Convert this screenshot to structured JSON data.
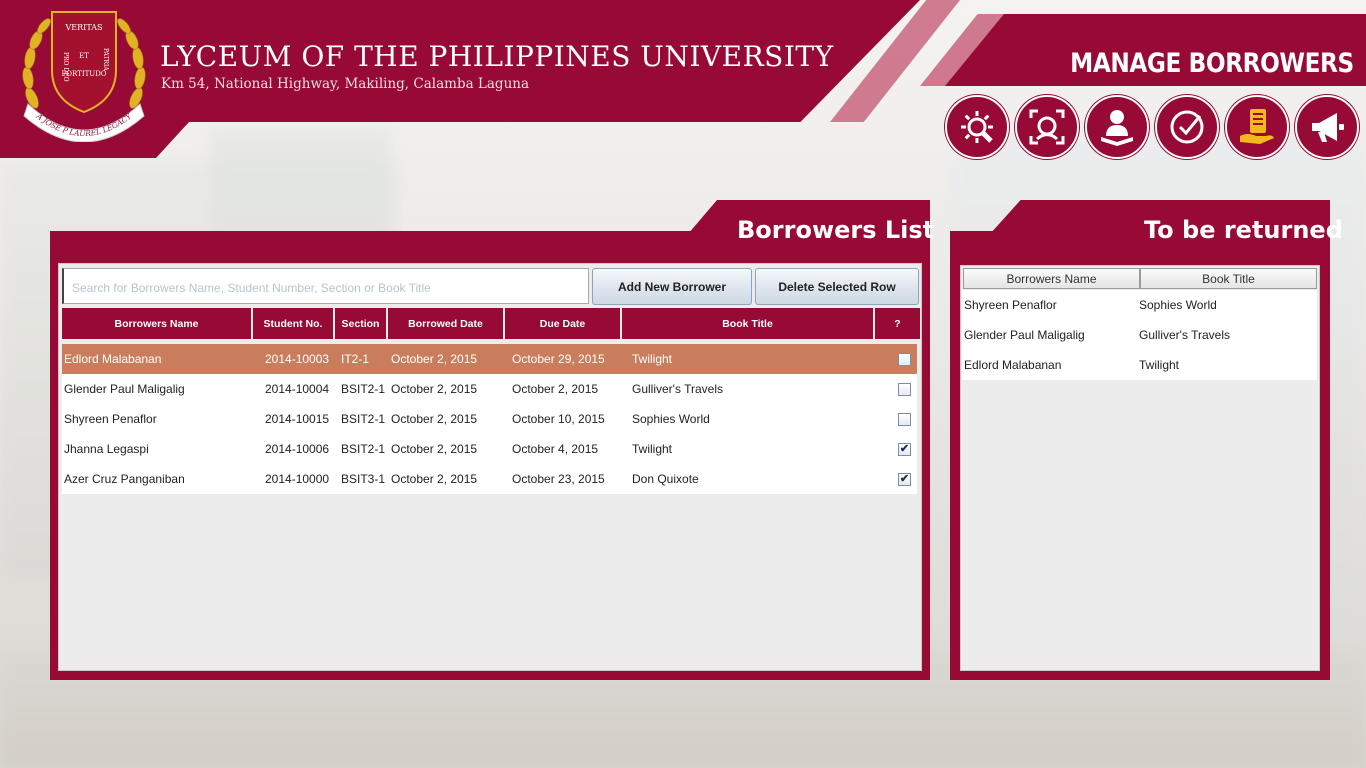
{
  "header": {
    "university_name": "LYCEUM OF THE PHILIPPINES UNIVERSITY",
    "address": "Km 54, National Highway, Makiling, Calamba Laguna",
    "page_title": "MANAGE BORROWERS",
    "logo": {
      "top_words": [
        "VERITAS",
        "ET"
      ],
      "left_word": "PRO DEO",
      "right_word": "PATRIA",
      "bottom_word": "FORTITUDO",
      "ribbon": "A JOSE P LAUREL LEGACY"
    }
  },
  "nav_icons": [
    "settings-tools-icon",
    "face-scan-icon",
    "reader-icon",
    "clock-check-icon",
    "book-hand-icon",
    "megaphone-icon"
  ],
  "borrowers_panel": {
    "title": "Borrowers List",
    "search_placeholder": "Search for Borrowers Name, Student Number, Section or Book Title",
    "add_button": "Add New Borrower",
    "delete_button": "Delete Selected Row",
    "columns": [
      "Borrowers Name",
      "Student No.",
      "Section",
      "Borrowed Date",
      "Due Date",
      "Book Title",
      "?"
    ],
    "rows": [
      {
        "name": "Edlord Malabanan",
        "student_no": "2014-10003",
        "section": "IT2-1",
        "borrowed": "October 2, 2015",
        "due": "October 29, 2015",
        "book": "Twilight",
        "checked": false,
        "selected": true
      },
      {
        "name": "Glender Paul Maligalig",
        "student_no": "2014-10004",
        "section": "BSIT2-1",
        "borrowed": "October 2, 2015",
        "due": "October 2, 2015",
        "book": "Gulliver's Travels",
        "checked": false,
        "selected": false
      },
      {
        "name": "Shyreen Penaflor",
        "student_no": "2014-10015",
        "section": "BSIT2-1",
        "borrowed": "October 2, 2015",
        "due": "October 10, 2015",
        "book": "Sophies World",
        "checked": false,
        "selected": false
      },
      {
        "name": "Jhanna Legaspi",
        "student_no": "2014-10006",
        "section": "BSIT2-1",
        "borrowed": "October 2, 2015",
        "due": "October 4, 2015",
        "book": "Twilight",
        "checked": true,
        "selected": false
      },
      {
        "name": "Azer Cruz Panganiban",
        "student_no": "2014-10000",
        "section": "BSIT3-1",
        "borrowed": "October 2, 2015",
        "due": "October 23, 2015",
        "book": "Don Quixote",
        "checked": true,
        "selected": false
      }
    ]
  },
  "return_panel": {
    "title": "To be returned",
    "columns": [
      "Borrowers Name",
      "Book Title"
    ],
    "rows": [
      {
        "name": "Shyreen Penaflor",
        "book": "Sophies World"
      },
      {
        "name": "Glender Paul Maligalig",
        "book": "Gulliver's Travels"
      },
      {
        "name": "Edlord Malabanan",
        "book": "Twilight"
      }
    ]
  },
  "colors": {
    "brand": "#970a35",
    "selected_row": "#c97d5d",
    "stripe": "#c8667f"
  }
}
